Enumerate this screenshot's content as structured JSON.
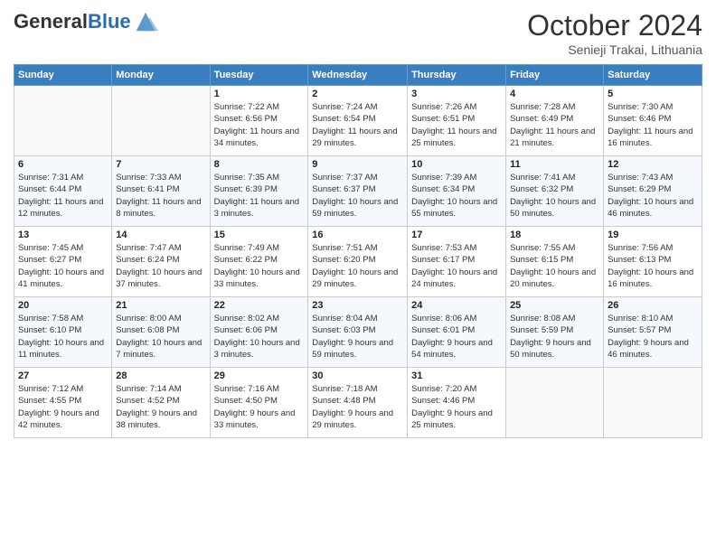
{
  "header": {
    "logo_general": "General",
    "logo_blue": "Blue",
    "month_title": "October 2024",
    "subtitle": "Senieji Trakai, Lithuania"
  },
  "weekdays": [
    "Sunday",
    "Monday",
    "Tuesday",
    "Wednesday",
    "Thursday",
    "Friday",
    "Saturday"
  ],
  "weeks": [
    [
      {
        "day": "",
        "info": ""
      },
      {
        "day": "",
        "info": ""
      },
      {
        "day": "1",
        "info": "Sunrise: 7:22 AM\nSunset: 6:56 PM\nDaylight: 11 hours\nand 34 minutes."
      },
      {
        "day": "2",
        "info": "Sunrise: 7:24 AM\nSunset: 6:54 PM\nDaylight: 11 hours\nand 29 minutes."
      },
      {
        "day": "3",
        "info": "Sunrise: 7:26 AM\nSunset: 6:51 PM\nDaylight: 11 hours\nand 25 minutes."
      },
      {
        "day": "4",
        "info": "Sunrise: 7:28 AM\nSunset: 6:49 PM\nDaylight: 11 hours\nand 21 minutes."
      },
      {
        "day": "5",
        "info": "Sunrise: 7:30 AM\nSunset: 6:46 PM\nDaylight: 11 hours\nand 16 minutes."
      }
    ],
    [
      {
        "day": "6",
        "info": "Sunrise: 7:31 AM\nSunset: 6:44 PM\nDaylight: 11 hours\nand 12 minutes."
      },
      {
        "day": "7",
        "info": "Sunrise: 7:33 AM\nSunset: 6:41 PM\nDaylight: 11 hours\nand 8 minutes."
      },
      {
        "day": "8",
        "info": "Sunrise: 7:35 AM\nSunset: 6:39 PM\nDaylight: 11 hours\nand 3 minutes."
      },
      {
        "day": "9",
        "info": "Sunrise: 7:37 AM\nSunset: 6:37 PM\nDaylight: 10 hours\nand 59 minutes."
      },
      {
        "day": "10",
        "info": "Sunrise: 7:39 AM\nSunset: 6:34 PM\nDaylight: 10 hours\nand 55 minutes."
      },
      {
        "day": "11",
        "info": "Sunrise: 7:41 AM\nSunset: 6:32 PM\nDaylight: 10 hours\nand 50 minutes."
      },
      {
        "day": "12",
        "info": "Sunrise: 7:43 AM\nSunset: 6:29 PM\nDaylight: 10 hours\nand 46 minutes."
      }
    ],
    [
      {
        "day": "13",
        "info": "Sunrise: 7:45 AM\nSunset: 6:27 PM\nDaylight: 10 hours\nand 41 minutes."
      },
      {
        "day": "14",
        "info": "Sunrise: 7:47 AM\nSunset: 6:24 PM\nDaylight: 10 hours\nand 37 minutes."
      },
      {
        "day": "15",
        "info": "Sunrise: 7:49 AM\nSunset: 6:22 PM\nDaylight: 10 hours\nand 33 minutes."
      },
      {
        "day": "16",
        "info": "Sunrise: 7:51 AM\nSunset: 6:20 PM\nDaylight: 10 hours\nand 29 minutes."
      },
      {
        "day": "17",
        "info": "Sunrise: 7:53 AM\nSunset: 6:17 PM\nDaylight: 10 hours\nand 24 minutes."
      },
      {
        "day": "18",
        "info": "Sunrise: 7:55 AM\nSunset: 6:15 PM\nDaylight: 10 hours\nand 20 minutes."
      },
      {
        "day": "19",
        "info": "Sunrise: 7:56 AM\nSunset: 6:13 PM\nDaylight: 10 hours\nand 16 minutes."
      }
    ],
    [
      {
        "day": "20",
        "info": "Sunrise: 7:58 AM\nSunset: 6:10 PM\nDaylight: 10 hours\nand 11 minutes."
      },
      {
        "day": "21",
        "info": "Sunrise: 8:00 AM\nSunset: 6:08 PM\nDaylight: 10 hours\nand 7 minutes."
      },
      {
        "day": "22",
        "info": "Sunrise: 8:02 AM\nSunset: 6:06 PM\nDaylight: 10 hours\nand 3 minutes."
      },
      {
        "day": "23",
        "info": "Sunrise: 8:04 AM\nSunset: 6:03 PM\nDaylight: 9 hours\nand 59 minutes."
      },
      {
        "day": "24",
        "info": "Sunrise: 8:06 AM\nSunset: 6:01 PM\nDaylight: 9 hours\nand 54 minutes."
      },
      {
        "day": "25",
        "info": "Sunrise: 8:08 AM\nSunset: 5:59 PM\nDaylight: 9 hours\nand 50 minutes."
      },
      {
        "day": "26",
        "info": "Sunrise: 8:10 AM\nSunset: 5:57 PM\nDaylight: 9 hours\nand 46 minutes."
      }
    ],
    [
      {
        "day": "27",
        "info": "Sunrise: 7:12 AM\nSunset: 4:55 PM\nDaylight: 9 hours\nand 42 minutes."
      },
      {
        "day": "28",
        "info": "Sunrise: 7:14 AM\nSunset: 4:52 PM\nDaylight: 9 hours\nand 38 minutes."
      },
      {
        "day": "29",
        "info": "Sunrise: 7:16 AM\nSunset: 4:50 PM\nDaylight: 9 hours\nand 33 minutes."
      },
      {
        "day": "30",
        "info": "Sunrise: 7:18 AM\nSunset: 4:48 PM\nDaylight: 9 hours\nand 29 minutes."
      },
      {
        "day": "31",
        "info": "Sunrise: 7:20 AM\nSunset: 4:46 PM\nDaylight: 9 hours\nand 25 minutes."
      },
      {
        "day": "",
        "info": ""
      },
      {
        "day": "",
        "info": ""
      }
    ]
  ]
}
